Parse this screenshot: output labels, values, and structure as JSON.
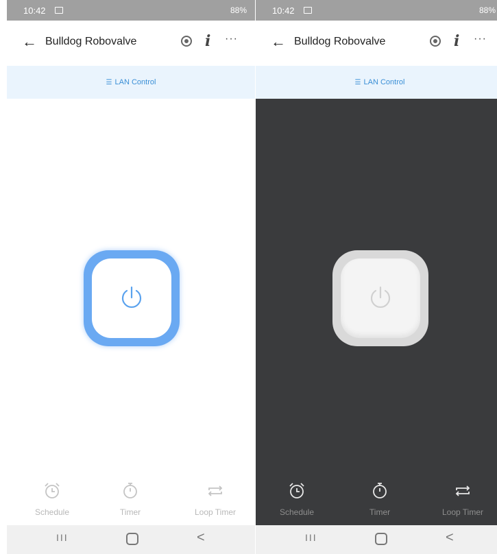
{
  "statusbar": {
    "time": "10:42",
    "status": "88%"
  },
  "appbar": {
    "title": "Bulldog Robovalve",
    "info_glyph": "i",
    "more_glyph": "···",
    "back_glyph": "←"
  },
  "lan": {
    "label": "LAN Control",
    "icon": "lan-network-icon"
  },
  "tabs": [
    {
      "label": "Schedule",
      "icon": "alarm-clock-icon"
    },
    {
      "label": "Timer",
      "icon": "stopwatch-icon"
    },
    {
      "label": "Loop Timer",
      "icon": "loop-arrows-icon"
    }
  ],
  "states": {
    "left": {
      "power": "on",
      "accent": "#6aa9f2",
      "background": "#ffffff"
    },
    "right": {
      "power": "off",
      "accent": "#d9d9d9",
      "background": "#3a3b3d"
    }
  },
  "navbar": {
    "recents": "III",
    "back": "<"
  }
}
